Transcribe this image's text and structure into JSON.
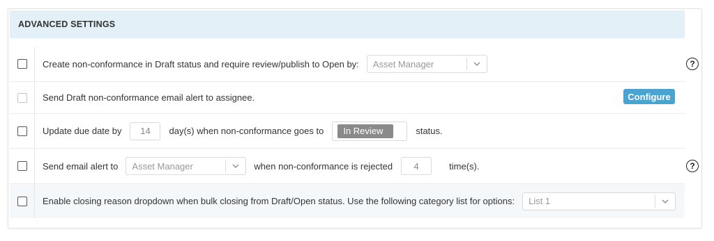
{
  "section": {
    "title": "ADVANCED SETTINGS"
  },
  "rows": {
    "draft_status": {
      "label": "Create non-conformance in Draft status and require review/publish to Open by:",
      "select_value": "Asset Manager",
      "checked": false
    },
    "draft_email": {
      "label": "Send Draft non-conformance email alert to assignee.",
      "button_label": "Configure",
      "checked": false,
      "disabled": true
    },
    "due_date": {
      "label_before": "Update due date by",
      "days_value": "14",
      "label_middle": "day(s) when non-conformance goes to",
      "status_value": "In Review",
      "label_after": "status.",
      "checked": false
    },
    "rejected_alert": {
      "label_before": "Send email alert to",
      "select_value": "Asset Manager",
      "label_middle": "when non-conformance is rejected",
      "times_value": "4",
      "label_after": "time(s).",
      "checked": false
    },
    "closing_reason": {
      "label": "Enable closing reason dropdown when bulk closing from Draft/Open status. Use the following category list for options:",
      "select_value": "List 1",
      "checked": false
    }
  },
  "help_icon": "?",
  "colors": {
    "header_bg": "#e4f0f7",
    "accent": "#4aa3d0",
    "status_pill": "#8a8a8a"
  }
}
